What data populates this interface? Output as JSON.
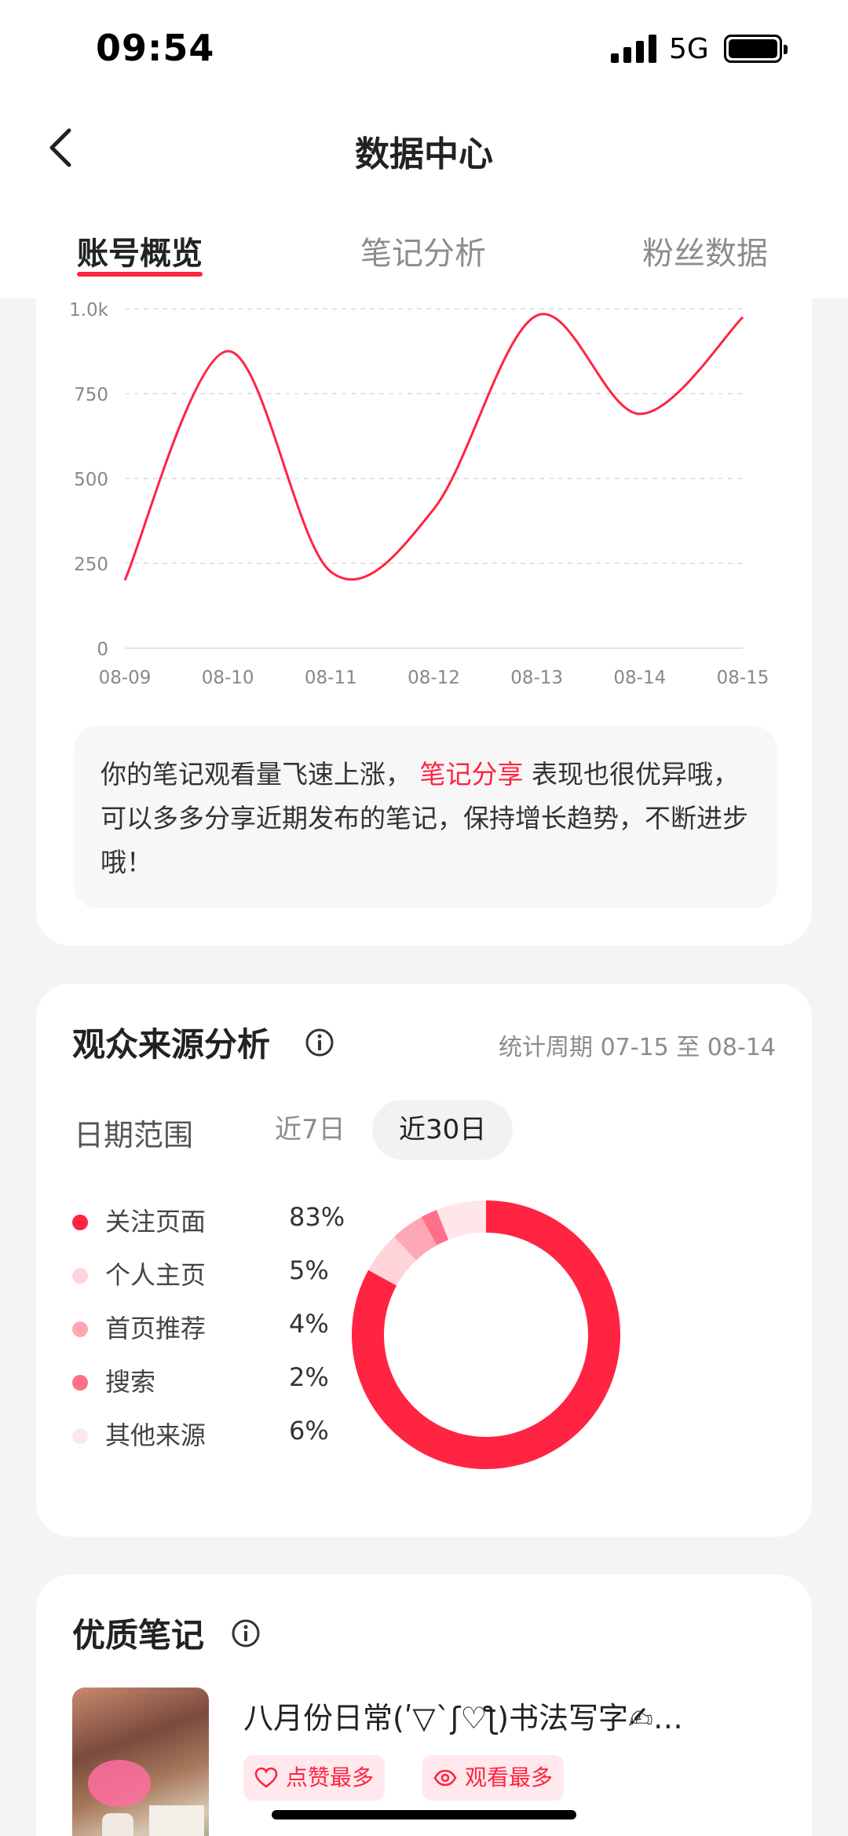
{
  "status_bar": {
    "time": "09:54",
    "network": "5G"
  },
  "header": {
    "title": "数据中心"
  },
  "tabs": [
    {
      "label": "账号概览",
      "active": true
    },
    {
      "label": "笔记分析",
      "active": false
    },
    {
      "label": "粉丝数据",
      "active": false
    }
  ],
  "views_chart": {
    "callout_before": "你的笔记观看量飞速上涨， ",
    "callout_highlight": "笔记分享",
    "callout_after": " 表现也很优异哦，可以多多分享近期发布的笔记，保持增长趋势，不断进步哦！"
  },
  "chart_data": {
    "type": "line",
    "x": [
      "08-09",
      "08-10",
      "08-11",
      "08-12",
      "08-13",
      "08-14",
      "08-15"
    ],
    "series": [
      {
        "values": [
          200,
          875,
          225,
          410,
          980,
          690,
          975
        ]
      }
    ],
    "yticks": [
      "0",
      "250",
      "500",
      "750",
      "1.0k"
    ],
    "ylim": [
      0,
      1000
    ],
    "grid": true,
    "line_color": "#ff2442"
  },
  "audience": {
    "title": "观众来源分析",
    "period": "统计周期 07-15 至 08-14",
    "range_label": "日期范围",
    "ranges": [
      {
        "label": "近7日",
        "active": false
      },
      {
        "label": "近30日",
        "active": true
      }
    ],
    "sources": [
      {
        "name": "关注页面",
        "value": "83%",
        "pct": 83,
        "color": "#ff2442"
      },
      {
        "name": "个人主页",
        "value": "5%",
        "pct": 5,
        "color": "#ffd3da"
      },
      {
        "name": "首页推荐",
        "value": "4%",
        "pct": 4,
        "color": "#ffa8b5"
      },
      {
        "name": "搜索",
        "value": "2%",
        "pct": 2,
        "color": "#ff7088"
      },
      {
        "name": "其他来源",
        "value": "6%",
        "pct": 6,
        "color": "#ffe6ea"
      }
    ]
  },
  "quality_notes": {
    "title": "优质笔记",
    "items": [
      {
        "title": "八月份日常(ʹ▽`ʃ♡ƪ)书法写字✍…",
        "badges": [
          "点赞最多",
          "观看最多"
        ]
      }
    ]
  }
}
